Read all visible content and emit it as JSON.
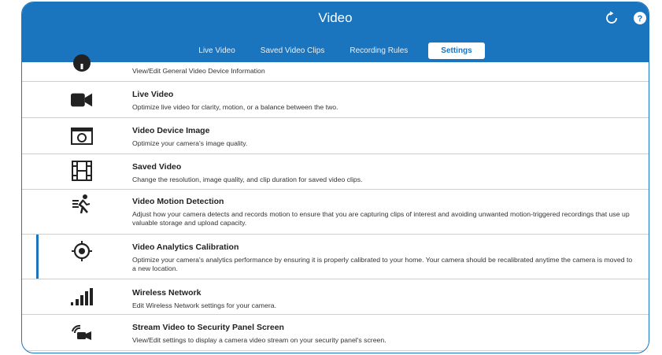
{
  "header": {
    "title": "Video",
    "refresh_icon": "refresh-icon",
    "help_icon": "help-icon"
  },
  "tabs": [
    {
      "label": "Live Video",
      "active": false
    },
    {
      "label": "Saved Video Clips",
      "active": false
    },
    {
      "label": "Recording Rules",
      "active": false
    },
    {
      "label": "Settings",
      "active": true
    }
  ],
  "settings": [
    {
      "name": "",
      "description": "View/Edit General Video Device Information",
      "icon": "info-icon"
    },
    {
      "name": "Live Video",
      "description": "Optimize live video for clarity, motion, or a balance between the two.",
      "icon": "video-camera-icon"
    },
    {
      "name": "Video Device Image",
      "description": "Optimize your camera's image quality.",
      "icon": "camera-image-icon"
    },
    {
      "name": "Saved Video",
      "description": "Change the resolution, image quality, and clip duration for saved video clips.",
      "icon": "film-icon"
    },
    {
      "name": "Video Motion Detection",
      "description": "Adjust how your camera detects and records motion to ensure that you are capturing clips of interest and avoiding unwanted motion-triggered recordings that use up valuable storage and upload capacity.",
      "icon": "running-person-icon"
    },
    {
      "name": "Video Analytics Calibration",
      "description": "Optimize your camera's analytics performance by ensuring it is properly calibrated to your home. Your camera should be recalibrated anytime the camera is moved to a new location.",
      "icon": "target-icon",
      "selected": true
    },
    {
      "name": "Wireless Network",
      "description": "Edit Wireless Network settings for your camera.",
      "icon": "signal-bars-icon"
    },
    {
      "name": "Stream Video to Security Panel Screen",
      "description": "View/Edit settings to display a camera video stream on your security panel's screen.",
      "icon": "stream-camera-icon"
    }
  ],
  "colors": {
    "accent": "#1a74be",
    "divider": "#cfcfcf"
  }
}
